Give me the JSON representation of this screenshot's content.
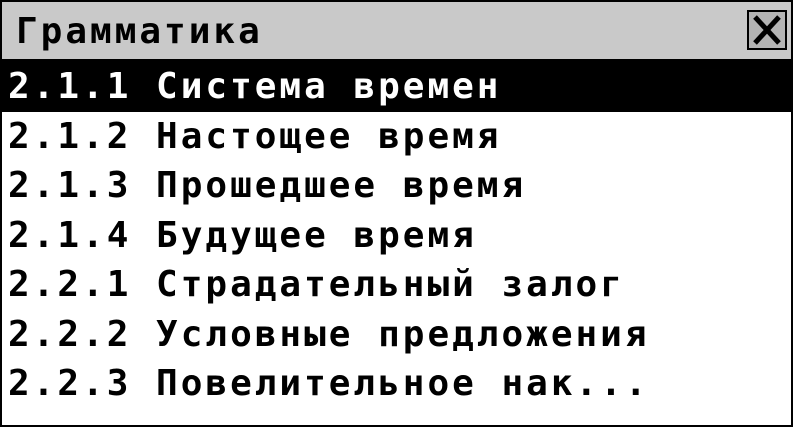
{
  "window": {
    "title": "Грамматика",
    "close_icon": "close-icon"
  },
  "menu": {
    "selected_index": 0,
    "items": [
      {
        "label": "2.1.1 Система времен"
      },
      {
        "label": "2.1.2 Настощее время"
      },
      {
        "label": "2.1.3 Прошедшее время"
      },
      {
        "label": "2.1.4 Будущее время"
      },
      {
        "label": "2.2.1 Страдательный залог"
      },
      {
        "label": "2.2.2 Условные предложения"
      },
      {
        "label": "2.2.3 Повелительное нак..."
      }
    ]
  },
  "colors": {
    "titlebar_bg": "#c9c9c9",
    "selected_bg": "#000000",
    "selected_fg": "#ffffff",
    "text": "#000000"
  }
}
